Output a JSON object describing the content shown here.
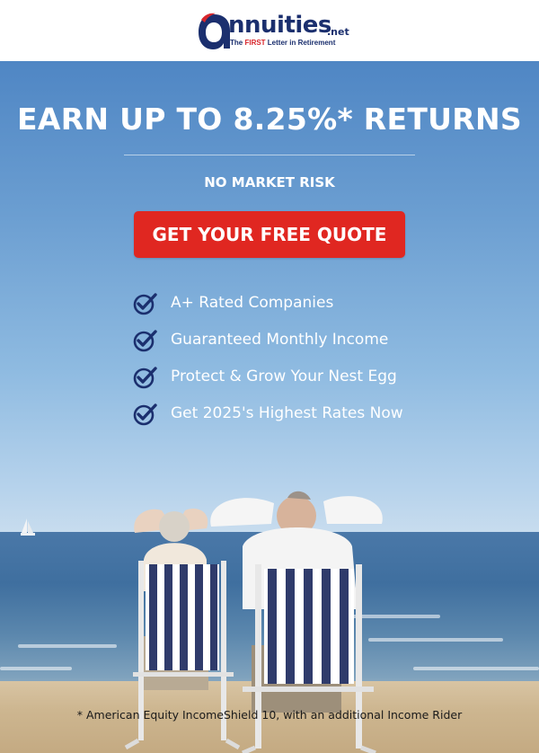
{
  "logo": {
    "word": "nnuities",
    "tld": ".net",
    "tagline_prefix": "The ",
    "tagline_first": "FIRST",
    "tagline_suffix": " Letter in Retirement",
    "colors": {
      "navy": "#1b2f6e",
      "red": "#d8262c"
    }
  },
  "hero": {
    "headline": "EARN UP TO 8.25%* RETURNS",
    "subhead": "NO MARKET RISK",
    "cta_label": "GET YOUR FREE QUOTE",
    "features": [
      {
        "label": "A+ Rated Companies",
        "icon": "checkmark-circle-icon"
      },
      {
        "label": "Guaranteed Monthly Income",
        "icon": "checkmark-circle-icon"
      },
      {
        "label": "Protect & Grow Your Nest Egg",
        "icon": "checkmark-circle-icon"
      },
      {
        "label": "Get 2025's Highest Rates Now",
        "icon": "checkmark-circle-icon"
      }
    ],
    "disclaimer": "* American Equity IncomeShield 10, with an additional Income Rider",
    "colors": {
      "cta": "#e02721",
      "check": "#1b2f6e",
      "sky": "#4f86c4"
    }
  }
}
